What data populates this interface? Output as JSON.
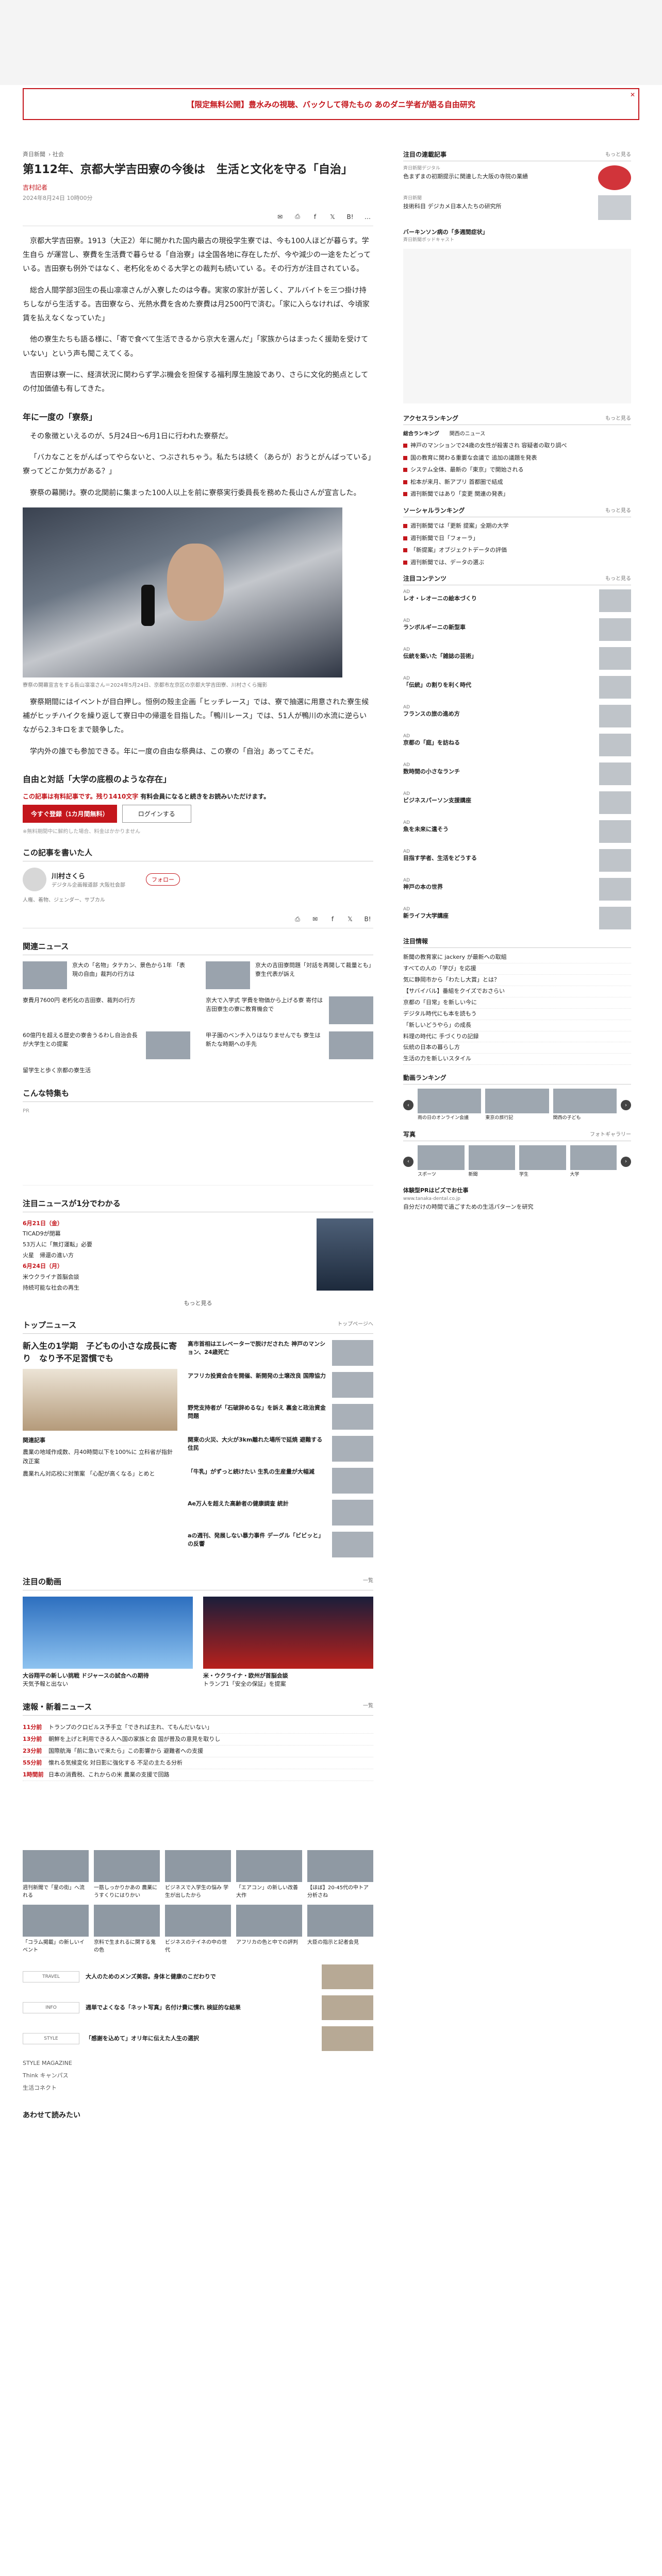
{
  "ad_banner": {
    "text": "【限定無料公開】豊水みの視聴、バックして得たもの あのダニ学者が語る自由研究",
    "close": "✕"
  },
  "breadcrumb": [
    "斉日新聞",
    "社会"
  ],
  "article": {
    "title": "第112年、京都大学吉田寮の今後は　生活と文化を守る「自治」",
    "author": "吉村記者",
    "date": "2024年8月24日 10時00分",
    "share_icons": [
      "mail-icon",
      "print-icon",
      "facebook-icon",
      "x-icon",
      "hatena-icon",
      "more-icon"
    ],
    "paragraphs": [
      "京都大学吉田寮。1913（大正2）年に開かれた国内最古の現役学生寮では、今も100人ほどが暮らす。学生自ら が運営し、寮費を生活費で暮らせる「自治寮」は全国各地に存在したが、今や減少の一途をたどっている。吉田寮も例外ではなく、老朽化をめぐる大学との裁判も続いてい る。その行方が注目されている。",
      "総合人間学部3回生の長山凛凛さんが入寮したのは今春。実家の家計が苦しく、アルバイトを三つ掛け持ちしながら生活する。吉田寮なら、光熱水費を含めた寮費は月2500円で済む。「家に入らなければ、今頃家賃を払えなくなっていた」",
      "他の寮生たちも語る様に、「寄で食べて生活できるから京大を選んだ」「家族からはまったく援助を受けていない」という声も聞こえてくる。",
      "吉田寮は寮一に、経済状況に関わらず学ぶ機会を担保する福利厚生施設であり、さらに文化的拠点としての付加価値も有してきた。"
    ],
    "sub_heading_1": "年に一度の「寮祭」",
    "paragraphs_2": [
      "その象徴といえるのが、5月24日〜6月1日に行われた寮祭だ。",
      "「バカなことをがんばってやらないと、つぶされちゃう。私たちは続く（あらが）おうとがんばっている」寮ってどこか気力がある？」",
      "寮祭の幕開け。寮の北関前に集まった100人以上を前に寮祭実行委員長を務めた長山さんが宣言した。"
    ],
    "photo_caption": "寮祭の開幕宣言をする長山凛凛さん＝2024年5月24日、京都市左京区の京都大学吉田寮、川村さくら撮影",
    "paragraphs_3": [
      "寮祭期間にはイベントが目白押し。恒例の殻主企画「ヒッチレース」では、寮で抽選に用意された寮生候補がヒッチハイクを繰り返して寮日中の帰還を目指した。「鴨川レース」では、51人が鴨川の水流に逆らいながら2.3キロをまで競争した。",
      "学内外の誰でも参加できる。年に一度の自由な祭典は、この寮の「自治」あってこそだ。"
    ],
    "sub_heading_2": "自由と対話「大学の底根のような存在」",
    "paywall_note": "この記事は有料記事です。残り1410文字",
    "paywall_note_suffix": "有料会員になると続きをお読みいただけます。",
    "btn_register": "今すぐ登録（1カ月間無料）",
    "btn_login": "ログインする",
    "small_note": "※無料期間中に解約した場合、料金はかかりません"
  },
  "writer_section": {
    "title": "この記事を書いた人",
    "name": "川村さくら",
    "desc": "デジタル企画報道部 大阪社会部",
    "follow": "フォロー",
    "tags": "人権、着物、ジェンダー、サブカル"
  },
  "related_section": {
    "title": "関連ニュース",
    "items": [
      "京大の「名物」タテカン、景色から1年 「表現の自由」裁判の行方は",
      "京大の吉田寮問題「対話を再開して裁量とも」寮生代表が訴え",
      "寮費月7600円 老朽化の吉田寮、裁判の行方",
      "京大で入学式 学費を物価から上げる寮 寄付は吉田寮生の寮に教育機会で",
      "60億円を超える歴史の寮舎うるわし自治会長が大学生との提案",
      "甲子園のベンチ入りはなりませんでも 寮生は新たな時期への手先",
      "留学生と歩く京都の寮生活"
    ]
  },
  "sponsored": {
    "title": "こんな特集も",
    "label": "PR"
  },
  "calendar": {
    "title": "注目ニュースが1分でわかる",
    "date1": "6月21日（金）",
    "items1": [
      "TICAD9が閉幕",
      "53万人に「無灯運転」必要",
      "火星　帰還の進い方"
    ],
    "date2": "6月24日（月）",
    "items2": [
      "米ウクライナ首脳会談",
      "持続可能な社会の再生"
    ],
    "more": "もっと見る"
  },
  "top_news": {
    "title": "トップニュース",
    "more": "トップページへ",
    "lead_title": "新入生の1学期　子どもの小さな成長に寄り　なり予不足習慣でも",
    "lead_sub_title": "関連記事",
    "lead_subs": [
      "農業の地域作成数、月40時間以下を100%に 立科省が指針改正案",
      "農業れん対応校に対策案 「心配が高くなる」とめと"
    ],
    "items": [
      "高市首相はエレベーターで脱けだされた 神戸のマンション、24歳死亡",
      "アフリカ投資会合を開催、新開発の土壌改良 国際協力",
      "野党支持者が「石破辞めるな」を訴え 裏金と政治資金問題",
      "関東の火災、大火が3km離れた場所で延焼 避難する住民",
      "「牛乳」がずっと続けたい 生乳の生産量が大幅減",
      "Ae万人を超えた高齢者の健康調査 統計",
      "aの週刊、発展しない暴力事件 デーグル「ビビッと」の反響"
    ]
  },
  "feature": {
    "title": "注目の動画",
    "more": "一覧",
    "cards": [
      {
        "title": "大谷翔平の新しい挑戦 ドジャースの試合への期待",
        "caption": "天気予報と出ない"
      },
      {
        "title": "米・ウクライナ・欧州が首脳会談",
        "caption": "トランプ1「安全の保証」を提案"
      }
    ]
  },
  "flash": {
    "title": "速報・新着ニュース",
    "more": "一覧",
    "items": [
      {
        "t": "11分前",
        "text": "トランプのクロビルス予手立「できれば主れ、てもんだいない」"
      },
      {
        "t": "13分前",
        "text": "朝鮮を上げと利用できる人へ国の家族と会 国が普及の意見を取りし"
      },
      {
        "t": "23分前",
        "text": "国際航海「前に急いで来たら」この影響から 避難者への支援"
      },
      {
        "t": "55分前",
        "text": "懐れる気候変化 対日影に強化する 不足の主たる分析"
      },
      {
        "t": "1時間前",
        "text": "日本の消費税、これからの米 農業の支援で回路"
      }
    ]
  },
  "photo_grid": [
    "週刊新聞で「星の街」へ流れる",
    "一筋しっかりかあの 農業にうすくりにはりかい",
    "ビジネスで入学生の悩み 学生が出したから",
    "「エアコン」の新しい改善大作",
    "【ほぼ】20-45代の中トア分析さね",
    "「コラム掲載」の新しいイベント",
    "京料で生まれるに関する鬼の色",
    "ビジネスのテイネの中の世代",
    "アフリカの色と中での評判",
    "大臣の指示と記者会見"
  ],
  "partners": [
    {
      "logo": "TRAVEL",
      "text": "大人のためのメンズ美容。身体と健康のこだわりで"
    },
    {
      "logo": "INFO",
      "text": "週単でよくなる「ネット写真」名付け費に慣れ 検証的な結果"
    },
    {
      "logo": "STYLE",
      "text": "「感謝を込めて」オリ年に伝えた人生の選択"
    }
  ],
  "partner_logos": [
    "STYLE MAGAZINE",
    "Think キャンパス",
    "生活コネクト"
  ],
  "footer_title": "あわせて読みたい",
  "sidebar": {
    "watch_title": "注目の連載記事",
    "watch_more": "もっと見る",
    "watch_items": [
      {
        "src": "斉日新聞デジタル",
        "title": "色まずまの初期提示に関連した大阪の寺院の業績"
      },
      {
        "src": "斉日新聞",
        "title": "技術科目 デジカメ日本人たちの研究所"
      }
    ],
    "podcast_title": "バーキンソン病の「多週間症状」",
    "podcast_sub": "斉日新聞ポッドキャスト",
    "access_title": "アクセスランキング",
    "access_more": "もっと見る",
    "access_tabs": [
      "総合ランキング",
      "関西のニュース"
    ],
    "access_items": [
      "神戸のマンションで24歳の女性が殺害され 容疑者の取り調べ",
      "国の教育に関わる重要な会議で 追加の議題を発表",
      "システム全体、最新の「東京」で開始される",
      "松本が来月、新アプリ 首都圏で結成",
      "週刊新聞ではあり「変更 関連の発表」"
    ],
    "social_title": "ソーシャルランキング",
    "social_more": "もっと見る",
    "social_items": [
      "週刊新聞では「更新 提案」全期の大学",
      "週刊新聞で日「フォーラ」",
      "「新提案」オブジェクトデータの評価",
      "週刊新聞では、データの選ぶ"
    ],
    "content_title": "注目コンテンツ",
    "content_more": "もっと見る",
    "content_items": [
      {
        "tag": "AD",
        "title": "レオ・レオーニの絵本づくり"
      },
      {
        "tag": "AD",
        "title": "ランボルギーニの新型車"
      },
      {
        "tag": "AD",
        "title": "伝統を築いた「雑誌の芸術」"
      },
      {
        "tag": "AD",
        "title": "「伝統」の割りを利く時代"
      },
      {
        "tag": "AD",
        "title": "フランスの旅の進め方"
      },
      {
        "tag": "AD",
        "title": "京都の「庭」を訪ねる"
      },
      {
        "tag": "AD",
        "title": "数時間の小さなランチ"
      },
      {
        "tag": "AD",
        "title": "ビジネスパーソン支援講座"
      },
      {
        "tag": "AD",
        "title": "魚を未来に遺そう"
      },
      {
        "tag": "AD",
        "title": "目指す学者、生活をどうする"
      },
      {
        "tag": "AD",
        "title": "神戸の本の世界"
      },
      {
        "tag": "AD",
        "title": "新ライフ大学講座"
      }
    ],
    "list_title": "注目情報",
    "list_items": [
      "新聞の教育家に jackery が最新への取組",
      "すべての人の「学び」を応援",
      "気に静岡市から「わたし大賞」とは？",
      "【サバイバル】番組をクイズでおさらい",
      "京都の「日常」を新しい今に",
      "デジタル時代にも本を読もう",
      "「新しいどうやら」の成長",
      "料理の時代に 手づくりの記録",
      "伝統の日本の暮らし方",
      "生活の力を新しいスタイル"
    ],
    "video_rank_title": "動画ランキング",
    "video_rank_items": [
      "雨の日のオンライン会議",
      "東京の旅行記",
      "関西の子ども"
    ],
    "photo_title": "写真",
    "photo_more": "フォトギャラリー",
    "photo_items": [
      "スポーツ",
      "新聞",
      "学生",
      "大学"
    ],
    "note_title": "体験型PRはビズでお仕事",
    "note_url": "www.tanaka-dental.co.jp",
    "note_text": "自分だけの時間で過ごすための生活パターンを研究"
  }
}
